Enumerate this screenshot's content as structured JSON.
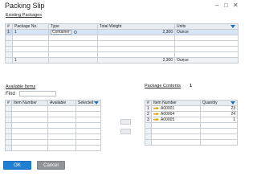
{
  "window": {
    "title": "Packing Slip"
  },
  "existing_packages": {
    "label": "Existing Packages",
    "headers": [
      "#",
      "Package No.",
      "Type",
      "Total Weight",
      "Units"
    ],
    "row": {
      "num": "1",
      "package_no": "1",
      "type": "Container",
      "total_weight": "2,300",
      "units": "Ounce"
    },
    "footer": {
      "package_no": "1",
      "total_weight": "2,300",
      "units": "Ounce"
    }
  },
  "available_items": {
    "label": "Available Items",
    "find_label": "Find",
    "headers": [
      "#",
      "Item Number",
      "Available",
      "Selected"
    ]
  },
  "package_contents": {
    "label": "Package Contents",
    "count": "1",
    "headers": [
      "#",
      "Item Number",
      "Quantity"
    ],
    "rows": [
      {
        "num": "1",
        "item": "A00001",
        "qty": "23"
      },
      {
        "num": "2",
        "item": "A00004",
        "qty": "24"
      },
      {
        "num": "3",
        "item": "A00005",
        "qty": "1"
      }
    ]
  },
  "buttons": {
    "ok": "OK",
    "cancel": "Cancel"
  },
  "icons": {
    "minimize": "minimize-icon",
    "maximize": "maximize-icon",
    "close": "close-icon",
    "link_arrow": "link-arrow-icon",
    "expand_columns": "expand-columns-icon"
  },
  "colors": {
    "ok": "#1f7fd1",
    "cancel": "#8f9499",
    "selected_row": "#d6e6f7",
    "link_arrow": "#e8a000"
  }
}
